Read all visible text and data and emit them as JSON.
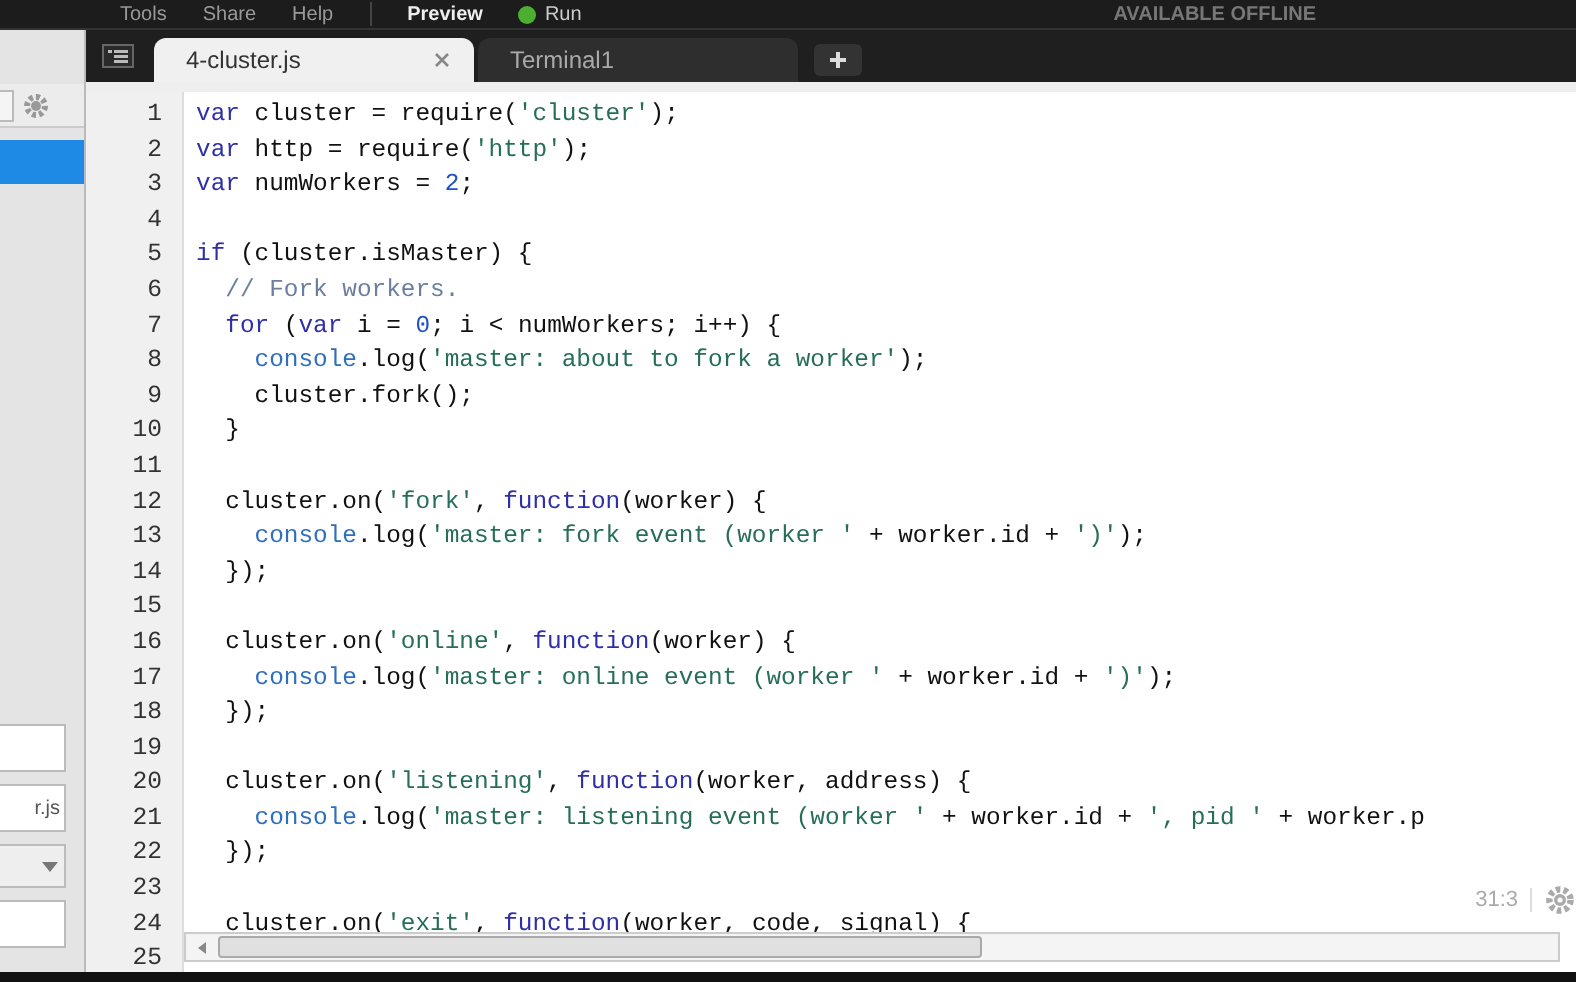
{
  "menu_bar": {
    "items": [
      "Tools",
      "Share",
      "Help"
    ],
    "preview": "Preview",
    "run": "Run",
    "offline_label": "AVAILABLE OFFLINE"
  },
  "tabs": [
    {
      "label": "4-cluster.js",
      "selected": true,
      "closable": true
    },
    {
      "label": "Terminal1",
      "selected": false,
      "closable": false
    }
  ],
  "sidebar": {
    "selected_row": true,
    "fields": [
      {
        "kind": "input"
      },
      {
        "kind": "input",
        "value": "r.js"
      },
      {
        "kind": "dropdown"
      },
      {
        "kind": "input"
      }
    ]
  },
  "editor": {
    "cursor_position": "31:3",
    "lines": [
      {
        "number": "1",
        "tokens": [
          {
            "kind": "keyword",
            "text": "var"
          },
          {
            "kind": "plain",
            "text": " cluster = require("
          },
          {
            "kind": "string",
            "text": "'cluster'"
          },
          {
            "kind": "plain",
            "text": ");"
          }
        ]
      },
      {
        "number": "2",
        "tokens": [
          {
            "kind": "keyword",
            "text": "var"
          },
          {
            "kind": "plain",
            "text": " http = require("
          },
          {
            "kind": "string",
            "text": "'http'"
          },
          {
            "kind": "plain",
            "text": ");"
          }
        ]
      },
      {
        "number": "3",
        "tokens": [
          {
            "kind": "keyword",
            "text": "var"
          },
          {
            "kind": "plain",
            "text": " numWorkers = "
          },
          {
            "kind": "number",
            "text": "2"
          },
          {
            "kind": "plain",
            "text": ";"
          }
        ]
      },
      {
        "number": "4"
      },
      {
        "number": "5",
        "tokens": [
          {
            "kind": "keyword",
            "text": "if"
          },
          {
            "kind": "plain",
            "text": " (cluster.isMaster) {"
          }
        ]
      },
      {
        "number": "6",
        "tokens": [
          {
            "kind": "comment",
            "text": "  // Fork workers."
          }
        ]
      },
      {
        "number": "7",
        "tokens": [
          {
            "kind": "keyword",
            "text": "  for"
          },
          {
            "kind": "plain",
            "text": " ("
          },
          {
            "kind": "keyword",
            "text": "var"
          },
          {
            "kind": "plain",
            "text": " i = "
          },
          {
            "kind": "number",
            "text": "0"
          },
          {
            "kind": "plain",
            "text": "; i < numWorkers; i++) {"
          }
        ]
      },
      {
        "number": "8",
        "tokens": [
          {
            "kind": "builtin",
            "text": "    console"
          },
          {
            "kind": "plain",
            "text": ".log("
          },
          {
            "kind": "string",
            "text": "'master: about to fork a worker'"
          },
          {
            "kind": "plain",
            "text": ");"
          }
        ]
      },
      {
        "number": "9",
        "tokens": [
          {
            "kind": "plain",
            "text": "    cluster.fork();"
          }
        ]
      },
      {
        "number": "10",
        "tokens": [
          {
            "kind": "plain",
            "text": "  }"
          }
        ]
      },
      {
        "number": "11"
      },
      {
        "number": "12",
        "tokens": [
          {
            "kind": "plain",
            "text": "  cluster.on("
          },
          {
            "kind": "string",
            "text": "'fork'"
          },
          {
            "kind": "plain",
            "text": ", "
          },
          {
            "kind": "keyword",
            "text": "function"
          },
          {
            "kind": "plain",
            "text": "(worker) {"
          }
        ]
      },
      {
        "number": "13",
        "tokens": [
          {
            "kind": "builtin",
            "text": "    console"
          },
          {
            "kind": "plain",
            "text": ".log("
          },
          {
            "kind": "string",
            "text": "'master: fork event (worker '"
          },
          {
            "kind": "plain",
            "text": " + worker.id + "
          },
          {
            "kind": "string",
            "text": "')'"
          },
          {
            "kind": "plain",
            "text": ");"
          }
        ]
      },
      {
        "number": "14",
        "tokens": [
          {
            "kind": "plain",
            "text": "  });"
          }
        ]
      },
      {
        "number": "15"
      },
      {
        "number": "16",
        "tokens": [
          {
            "kind": "plain",
            "text": "  cluster.on("
          },
          {
            "kind": "string",
            "text": "'online'"
          },
          {
            "kind": "plain",
            "text": ", "
          },
          {
            "kind": "keyword",
            "text": "function"
          },
          {
            "kind": "plain",
            "text": "(worker) {"
          }
        ]
      },
      {
        "number": "17",
        "tokens": [
          {
            "kind": "builtin",
            "text": "    console"
          },
          {
            "kind": "plain",
            "text": ".log("
          },
          {
            "kind": "string",
            "text": "'master: online event (worker '"
          },
          {
            "kind": "plain",
            "text": " + worker.id + "
          },
          {
            "kind": "string",
            "text": "')'"
          },
          {
            "kind": "plain",
            "text": ");"
          }
        ]
      },
      {
        "number": "18",
        "tokens": [
          {
            "kind": "plain",
            "text": "  });"
          }
        ]
      },
      {
        "number": "19"
      },
      {
        "number": "20",
        "tokens": [
          {
            "kind": "plain",
            "text": "  cluster.on("
          },
          {
            "kind": "string",
            "text": "'listening'"
          },
          {
            "kind": "plain",
            "text": ", "
          },
          {
            "kind": "keyword",
            "text": "function"
          },
          {
            "kind": "plain",
            "text": "(worker, address) {"
          }
        ]
      },
      {
        "number": "21",
        "tokens": [
          {
            "kind": "builtin",
            "text": "    console"
          },
          {
            "kind": "plain",
            "text": ".log("
          },
          {
            "kind": "string",
            "text": "'master: listening event (worker '"
          },
          {
            "kind": "plain",
            "text": " + worker.id + "
          },
          {
            "kind": "string",
            "text": "', pid '"
          },
          {
            "kind": "plain",
            "text": " + worker.p"
          }
        ]
      },
      {
        "number": "22",
        "tokens": [
          {
            "kind": "plain",
            "text": "  });"
          }
        ]
      },
      {
        "number": "23"
      },
      {
        "number": "24",
        "tokens": [
          {
            "kind": "plain",
            "text": "  cluster.on("
          },
          {
            "kind": "string",
            "text": "'exit'"
          },
          {
            "kind": "plain",
            "text": ", "
          },
          {
            "kind": "keyword",
            "text": "function"
          },
          {
            "kind": "plain",
            "text": "(worker, code, signal) {"
          }
        ]
      },
      {
        "number": "25"
      }
    ]
  }
}
